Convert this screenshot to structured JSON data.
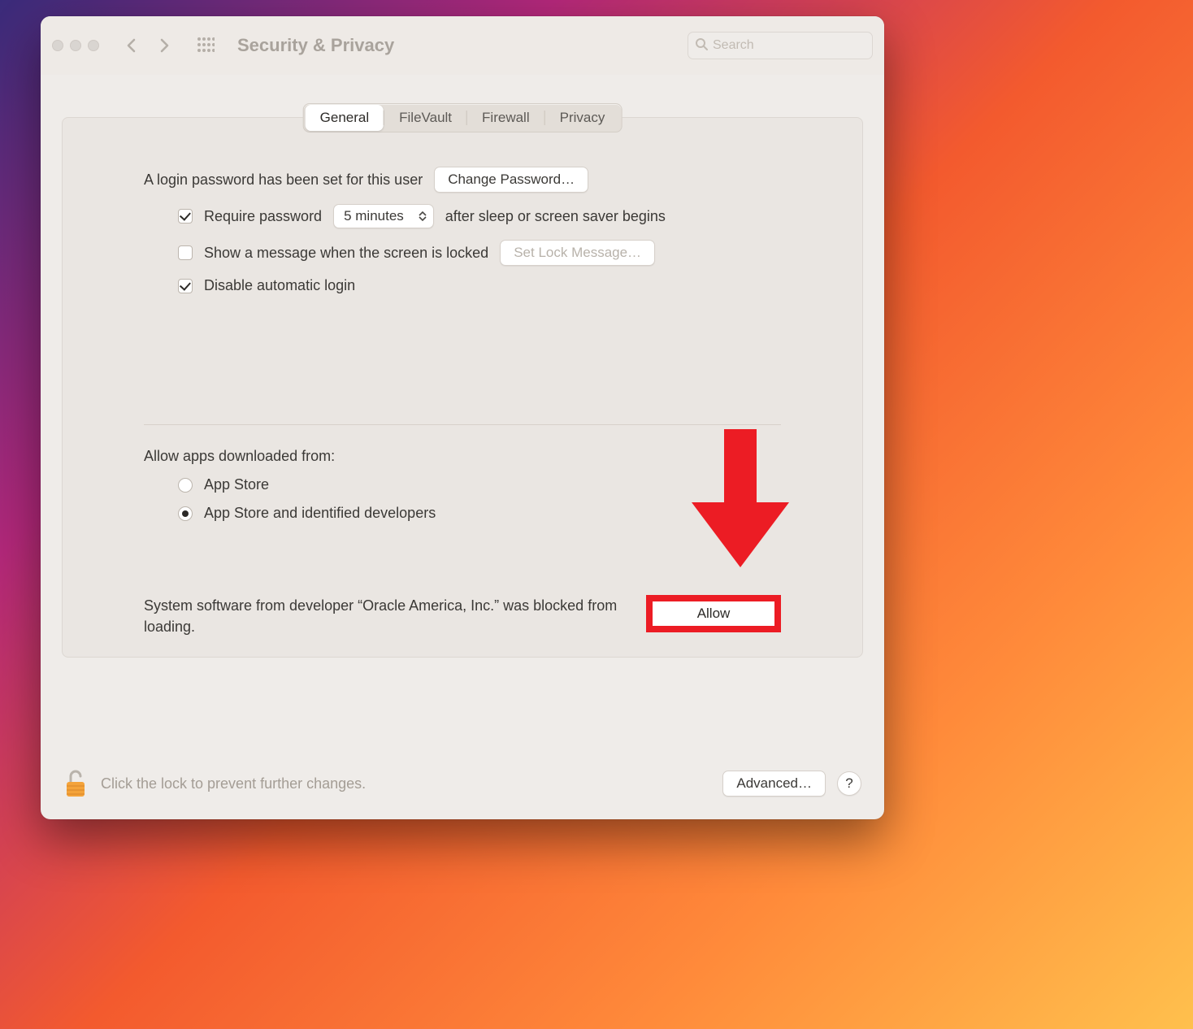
{
  "window": {
    "title": "Security & Privacy",
    "search_placeholder": "Search"
  },
  "tabs": [
    {
      "label": "General",
      "active": true
    },
    {
      "label": "FileVault",
      "active": false
    },
    {
      "label": "Firewall",
      "active": false
    },
    {
      "label": "Privacy",
      "active": false
    }
  ],
  "login": {
    "password_set_text": "A login password has been set for this user",
    "change_password_label": "Change Password…",
    "require_password_label": "Require password",
    "require_password_checked": true,
    "delay_selected": "5 minutes",
    "after_sleep_text": "after sleep or screen saver begins",
    "show_message_label": "Show a message when the screen is locked",
    "show_message_checked": false,
    "set_lock_message_label": "Set Lock Message…",
    "disable_auto_login_label": "Disable automatic login",
    "disable_auto_login_checked": true
  },
  "allow_apps": {
    "section_label": "Allow apps downloaded from:",
    "options": [
      {
        "label": "App Store",
        "selected": false
      },
      {
        "label": "App Store and identified developers",
        "selected": true
      }
    ]
  },
  "blocked": {
    "message": "System software from developer “Oracle America, Inc.” was blocked from loading.",
    "allow_label": "Allow"
  },
  "footer": {
    "lock_hint": "Click the lock to prevent further changes.",
    "advanced_label": "Advanced…",
    "help_label": "?"
  },
  "annotations": {
    "arrow_color": "#ec1c24",
    "highlight_target": "allow-button"
  }
}
